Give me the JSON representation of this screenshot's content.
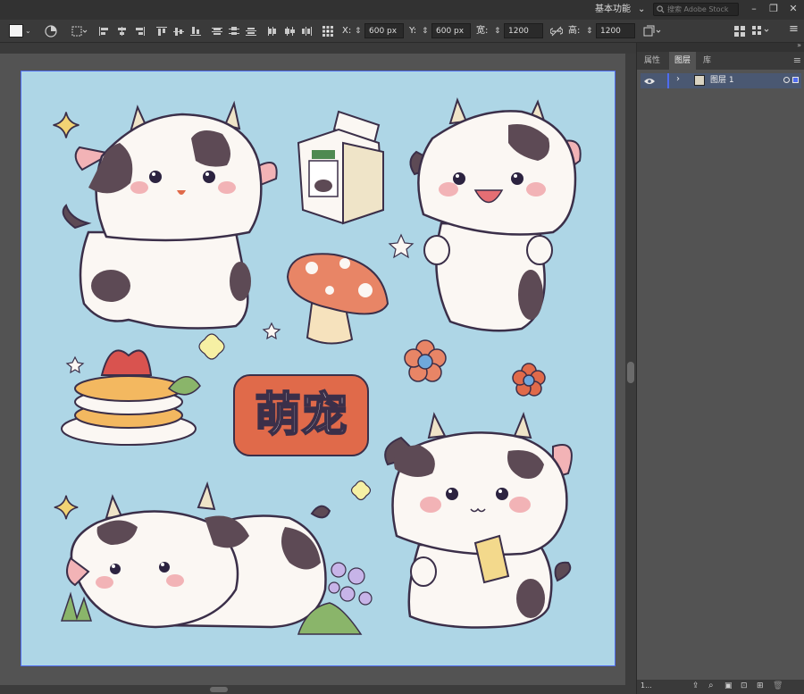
{
  "topbar": {
    "workspace_label": "基本功能",
    "search_placeholder": "搜索 Adobe Stock"
  },
  "controlbar": {
    "x_label": "X:",
    "x_value": "600 px",
    "y_label": "Y:",
    "y_value": "600 px",
    "w_label": "宽:",
    "w_value": "1200 px",
    "h_label": "高:",
    "h_value": "1200 px"
  },
  "panel": {
    "tabs": [
      {
        "label": "属性"
      },
      {
        "label": "图层"
      },
      {
        "label": "库"
      }
    ],
    "active_tab": "图层",
    "layers": [
      {
        "name": "图层 1",
        "visible": true
      }
    ],
    "layer_count": "1..."
  },
  "artwork": {
    "title_text": "萌宠"
  },
  "colors": {
    "artboard_bg": "#aed6e6",
    "selection": "#4f6cf0",
    "cow_white": "#fbf7f3",
    "cow_spot": "#5d4a55",
    "blush": "#f2b3b6",
    "accent_orange": "#e06a4a"
  }
}
